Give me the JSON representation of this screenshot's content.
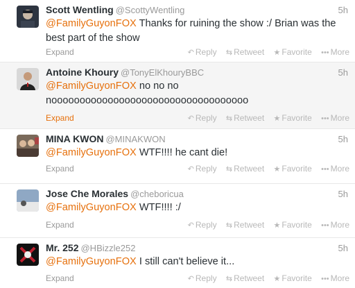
{
  "tweets": [
    {
      "name": "Scott Wentling",
      "handle": "@ScottyWentling",
      "time": "5h",
      "mention": "@FamilyGuyonFOX",
      "text": " Thanks for ruining the show :/ Brian was the best part of the show",
      "expand": "Expand",
      "reply": "Reply",
      "retweet": "Retweet",
      "favorite": "Favorite",
      "more": "More"
    },
    {
      "name": "Antoine Khoury",
      "handle": "@TonyElKhouryBBC",
      "time": "5h",
      "mention": "@FamilyGuyonFOX",
      "text": " no no no nooooooooooooooooooooooooooooooooooo",
      "expand": "Expand",
      "reply": "Reply",
      "retweet": "Retweet",
      "favorite": "Favorite",
      "more": "More"
    },
    {
      "name": "MINA KWON",
      "handle": "@MINAKWON",
      "time": "5h",
      "mention": "@FamilyGuyonFOX",
      "text": " WTF!!!! he cant die!",
      "expand": "Expand",
      "reply": "Reply",
      "retweet": "Retweet",
      "favorite": "Favorite",
      "more": "More"
    },
    {
      "name": "Jose Che Morales",
      "handle": "@cheboricua",
      "time": "5h",
      "mention": "@FamilyGuyonFOX",
      "text": " WTF!!!! :/",
      "expand": "Expand",
      "reply": "Reply",
      "retweet": "Retweet",
      "favorite": "Favorite",
      "more": "More"
    },
    {
      "name": "Mr. 252",
      "handle": "@HBizzle252",
      "time": "5h",
      "mention": "@FamilyGuyonFOX",
      "text": " I still can't believe it...",
      "expand": "Expand",
      "reply": "Reply",
      "retweet": "Retweet",
      "favorite": "Favorite",
      "more": "More"
    }
  ],
  "icons": {
    "reply": "reply-arrow-icon",
    "retweet": "retweet-icon",
    "favorite": "star-icon",
    "more": "ellipsis-icon"
  },
  "colors": {
    "mention": "#e6700c",
    "meta": "#999999",
    "action": "#b8b8b8",
    "highlight_bg": "#f5f5f5"
  }
}
